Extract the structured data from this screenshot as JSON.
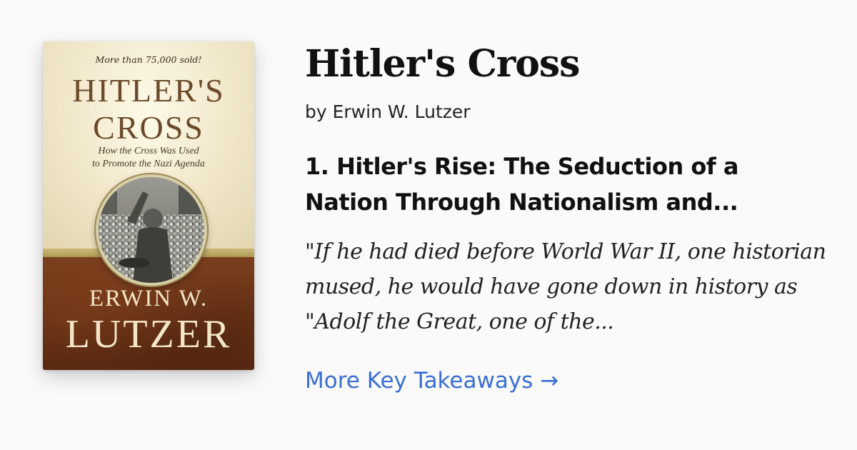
{
  "cover": {
    "tagline": "More than 75,000 sold!",
    "title_line1": "HITLER'S",
    "title_line2": "CROSS",
    "subtitle_line1": "How the Cross Was Used",
    "subtitle_line2": "to Promote the Nazi Agenda",
    "author_line1": "ERWIN W.",
    "author_line2": "LUTZER"
  },
  "book": {
    "title": "Hitler's Cross",
    "byline": "by Erwin W. Lutzer"
  },
  "takeaway": {
    "heading": "1. Hitler's Rise: The Seduction of a Nation Through Nationalism and...",
    "quote": "\"If he had died before World War II, one historian mused, he would have gone down in history as \"Adolf the Great, one of the..."
  },
  "link": {
    "label": "More Key Takeaways →"
  },
  "colors": {
    "background": "#fafafa",
    "link": "#3b6fd4",
    "cover_brown": "#6a3316",
    "cover_cream": "#efe5c6"
  }
}
